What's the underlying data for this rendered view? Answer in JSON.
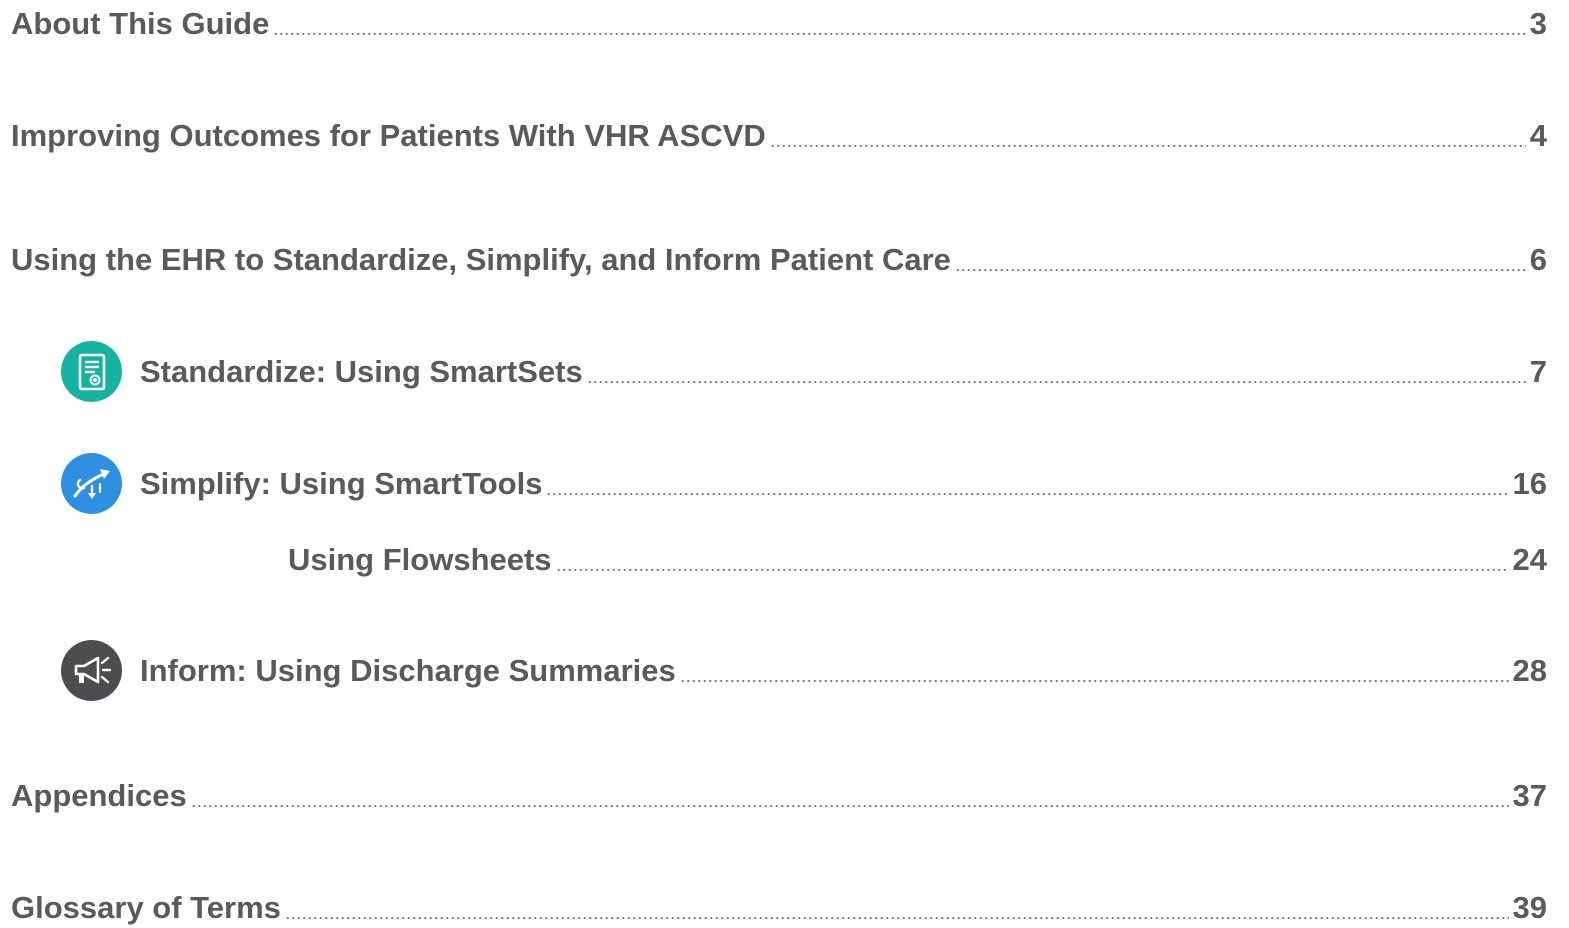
{
  "toc": {
    "about": {
      "title": "About This Guide",
      "page": "3"
    },
    "outcomes": {
      "title": "Improving Outcomes for Patients With VHR ASCVD",
      "page": "4"
    },
    "ehr": {
      "title": "Using the EHR to Standardize, Simplify, and Inform Patient Care",
      "page": "6"
    },
    "standardize": {
      "title": "Standardize: Using SmartSets",
      "page": "7",
      "icon": "smartset-document-icon",
      "color": "#14b4a0"
    },
    "simplify": {
      "title": "Simplify: Using SmartTools",
      "page": "16",
      "icon": "simplify-arrow-icon",
      "color": "#2f8fe0"
    },
    "flowsheets": {
      "title": "Using Flowsheets",
      "page": "24"
    },
    "inform": {
      "title": "Inform: Using Discharge Summaries",
      "page": "28",
      "icon": "megaphone-icon",
      "color": "#4d4d4f"
    },
    "appendices": {
      "title": "Appendices",
      "page": "37"
    },
    "glossary": {
      "title": "Glossary of Terms",
      "page": "39"
    }
  },
  "colors": {
    "text": "#5a5a5b",
    "dots": "#7a7a7b"
  }
}
